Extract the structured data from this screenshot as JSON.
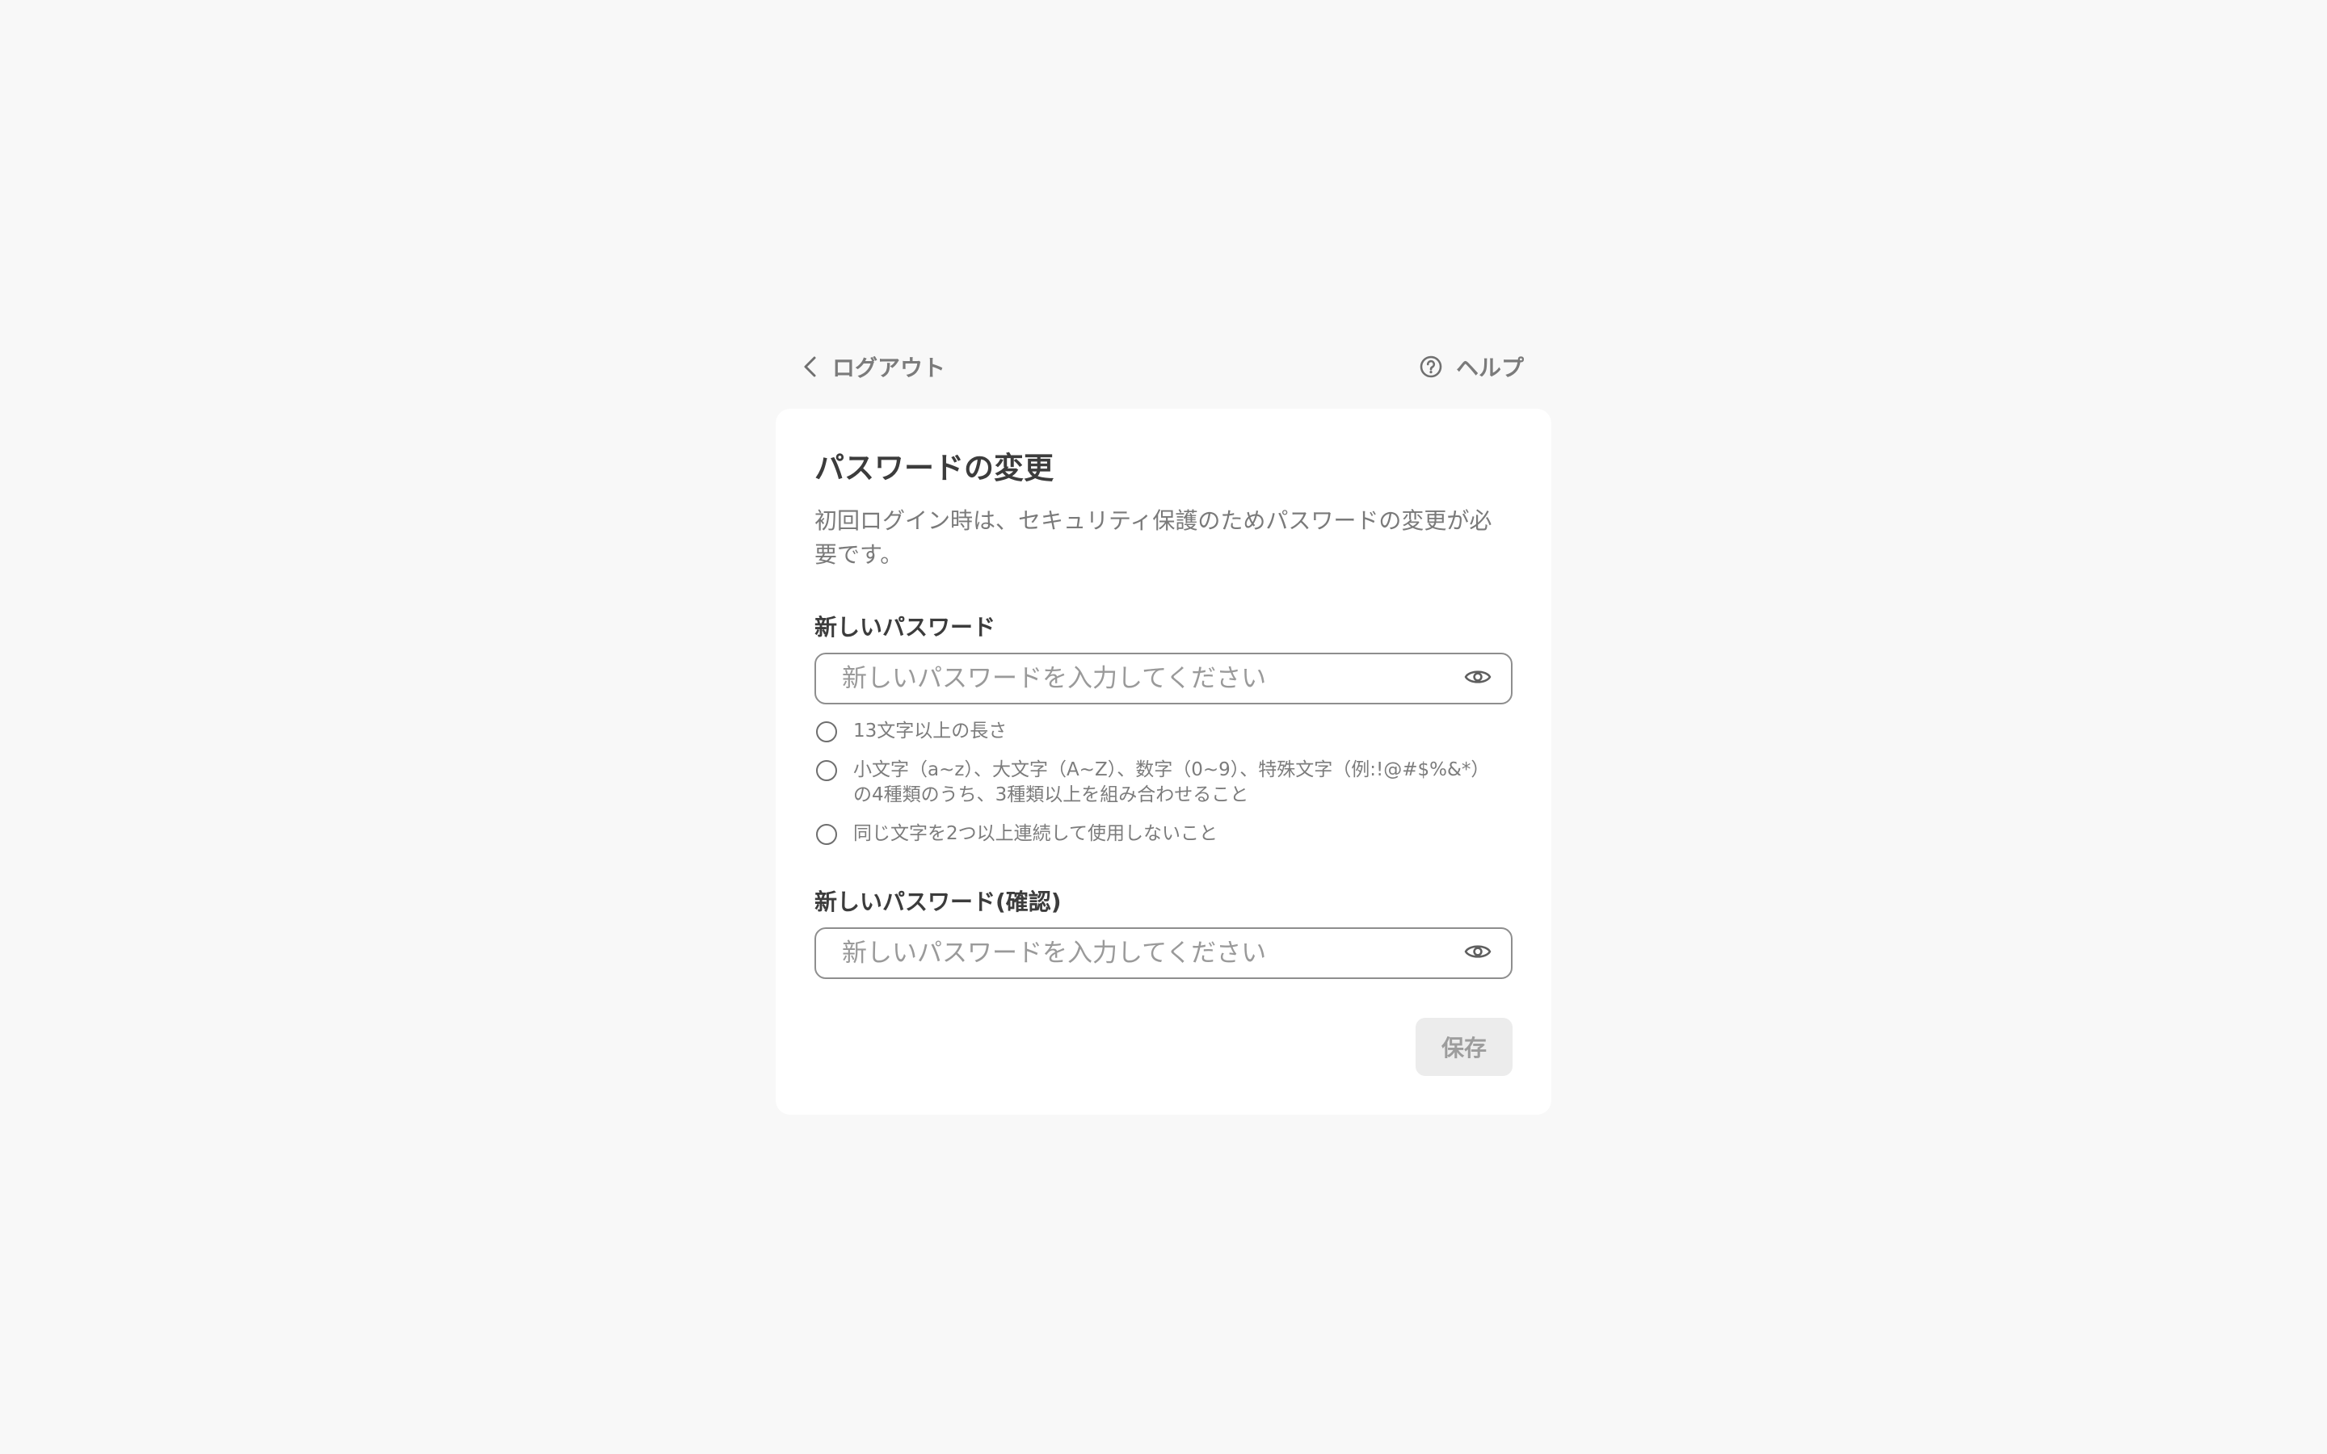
{
  "header": {
    "logout_label": "ログアウト",
    "logout_icon": "chevron-left-icon",
    "help_label": "ヘルプ",
    "help_icon": "question-circle-icon"
  },
  "card": {
    "title": "パスワードの変更",
    "description": "初回ログイン時は、セキュリティ保護のためパスワードの変更が必要です。",
    "new_password": {
      "label": "新しいパスワード",
      "placeholder": "新しいパスワードを入力してください",
      "value": ""
    },
    "rules": [
      {
        "text": "13文字以上の長さ",
        "met": false
      },
      {
        "text": "小文字（a~z）、大文字（A~Z）、数字（0~9）、特殊文字（例:!@#$%&*）の4種類のうち、3種類以上を組み合わせること",
        "met": false
      },
      {
        "text": "同じ文字を2つ以上連続して使用しないこと",
        "met": false
      }
    ],
    "confirm_password": {
      "label": "新しいパスワード(確認)",
      "placeholder": "新しいパスワードを入力してください",
      "value": ""
    },
    "save_label": "保存"
  },
  "colors": {
    "background": "#f8f8f8",
    "card": "#ffffff",
    "button_disabled_bg": "#ececec",
    "button_disabled_text": "#9d9d9d"
  }
}
